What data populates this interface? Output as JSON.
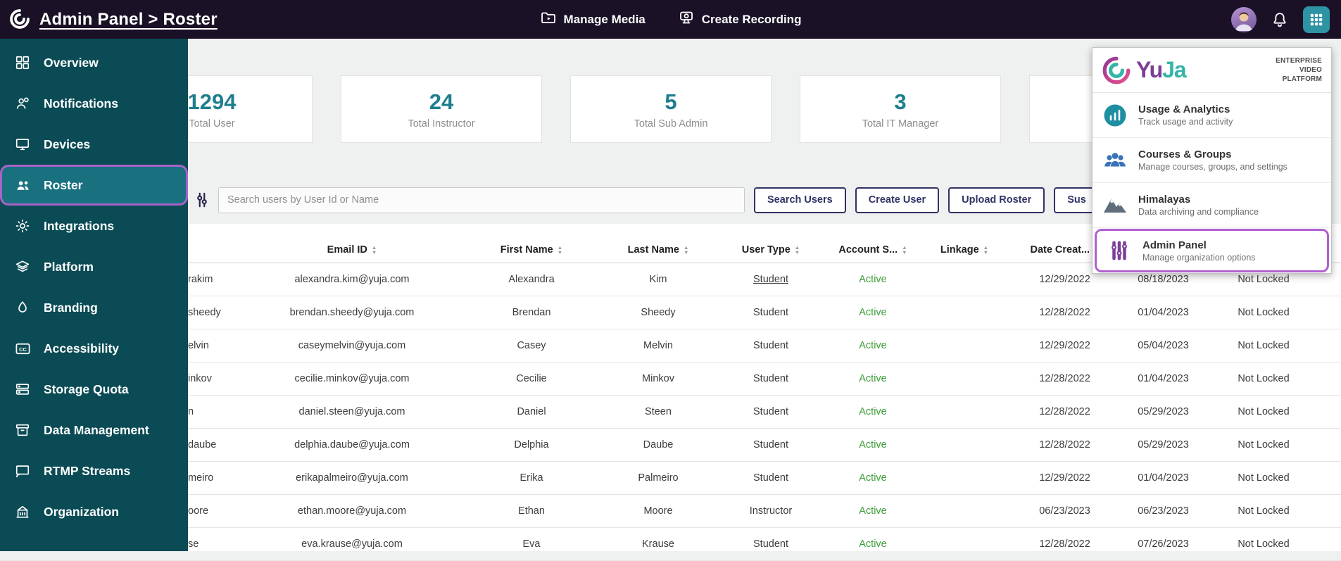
{
  "topbar": {
    "title": "Admin Panel > Roster",
    "manage_media_label": "Manage Media",
    "create_recording_label": "Create Recording"
  },
  "sidebar": {
    "items": [
      {
        "label": "Overview",
        "selected": false
      },
      {
        "label": "Notifications",
        "selected": false
      },
      {
        "label": "Devices",
        "selected": false
      },
      {
        "label": "Roster",
        "selected": true
      },
      {
        "label": "Integrations",
        "selected": false
      },
      {
        "label": "Platform",
        "selected": false
      },
      {
        "label": "Branding",
        "selected": false
      },
      {
        "label": "Accessibility",
        "selected": false
      },
      {
        "label": "Storage Quota",
        "selected": false
      },
      {
        "label": "Data Management",
        "selected": false
      },
      {
        "label": "RTMP Streams",
        "selected": false
      },
      {
        "label": "Organization",
        "selected": false
      }
    ]
  },
  "stats": {
    "cards": [
      {
        "value": "1294",
        "label": "Total User"
      },
      {
        "value": "24",
        "label": "Total Instructor"
      },
      {
        "value": "5",
        "label": "Total Sub Admin"
      },
      {
        "value": "3",
        "label": "Total IT Manager"
      }
    ]
  },
  "toolbar": {
    "search_placeholder": "Search users by User Id or Name",
    "search_users_label": "Search Users",
    "create_user_label": "Create User",
    "upload_roster_label": "Upload Roster",
    "suspend_label_visible": "Sus"
  },
  "table": {
    "headers": {
      "email": "Email ID",
      "first_name": "First Name",
      "last_name": "Last Name",
      "user_type": "User Type",
      "account_status": "Account S...",
      "linkage": "Linkage",
      "date_created": "Date Creat..."
    },
    "rows": [
      {
        "user_id_fragment": "rakim",
        "email": "alexandra.kim@yuja.com",
        "first_name": "Alexandra",
        "last_name": "Kim",
        "user_type": "Student",
        "account_status": "Active",
        "linkage": "",
        "date_created": "12/29/2022",
        "date2": "08/18/2023",
        "locked": "Not Locked"
      },
      {
        "user_id_fragment": "sheedy",
        "email": "brendan.sheedy@yuja.com",
        "first_name": "Brendan",
        "last_name": "Sheedy",
        "user_type": "Student",
        "account_status": "Active",
        "linkage": "",
        "date_created": "12/28/2022",
        "date2": "01/04/2023",
        "locked": "Not Locked"
      },
      {
        "user_id_fragment": "elvin",
        "email": "caseymelvin@yuja.com",
        "first_name": "Casey",
        "last_name": "Melvin",
        "user_type": "Student",
        "account_status": "Active",
        "linkage": "",
        "date_created": "12/29/2022",
        "date2": "05/04/2023",
        "locked": "Not Locked"
      },
      {
        "user_id_fragment": "inkov",
        "email": "cecilie.minkov@yuja.com",
        "first_name": "Cecilie",
        "last_name": "Minkov",
        "user_type": "Student",
        "account_status": "Active",
        "linkage": "",
        "date_created": "12/28/2022",
        "date2": "01/04/2023",
        "locked": "Not Locked"
      },
      {
        "user_id_fragment": "n",
        "email": "daniel.steen@yuja.com",
        "first_name": "Daniel",
        "last_name": "Steen",
        "user_type": "Student",
        "account_status": "Active",
        "linkage": "",
        "date_created": "12/28/2022",
        "date2": "05/29/2023",
        "locked": "Not Locked"
      },
      {
        "user_id_fragment": "daube",
        "email": "delphia.daube@yuja.com",
        "first_name": "Delphia",
        "last_name": "Daube",
        "user_type": "Student",
        "account_status": "Active",
        "linkage": "",
        "date_created": "12/28/2022",
        "date2": "05/29/2023",
        "locked": "Not Locked"
      },
      {
        "user_id_fragment": "meiro",
        "email": "erikapalmeiro@yuja.com",
        "first_name": "Erika",
        "last_name": "Palmeiro",
        "user_type": "Student",
        "account_status": "Active",
        "linkage": "",
        "date_created": "12/29/2022",
        "date2": "01/04/2023",
        "locked": "Not Locked"
      },
      {
        "user_id_fragment": "oore",
        "email": "ethan.moore@yuja.com",
        "first_name": "Ethan",
        "last_name": "Moore",
        "user_type": "Instructor",
        "account_status": "Active",
        "linkage": "",
        "date_created": "06/23/2023",
        "date2": "06/23/2023",
        "locked": "Not Locked"
      },
      {
        "user_id_fragment": "se",
        "email": "eva.krause@yuja.com",
        "first_name": "Eva",
        "last_name": "Krause",
        "user_type": "Student",
        "account_status": "Active",
        "linkage": "",
        "date_created": "12/28/2022",
        "date2": "07/26/2023",
        "locked": "Not Locked"
      }
    ]
  },
  "apps_menu": {
    "brand_yu": "Yu",
    "brand_ja": "Ja",
    "tagline": [
      "ENTERPRISE",
      "VIDEO",
      "PLATFORM"
    ],
    "items": [
      {
        "title": "Usage & Analytics",
        "desc": "Track usage and activity",
        "selected": false
      },
      {
        "title": "Courses & Groups",
        "desc": "Manage courses, groups, and settings",
        "selected": false
      },
      {
        "title": "Himalayas",
        "desc": "Data archiving and compliance",
        "selected": false
      },
      {
        "title": "Admin Panel",
        "desc": "Manage organization options",
        "selected": true
      }
    ]
  },
  "colors": {
    "accent_teal": "#1e7e8e",
    "active_green": "#3f9e39",
    "highlight_purple": "#b05fd0",
    "sidebar_teal": "#0a4b55",
    "topbar_dark": "#1a1126"
  }
}
